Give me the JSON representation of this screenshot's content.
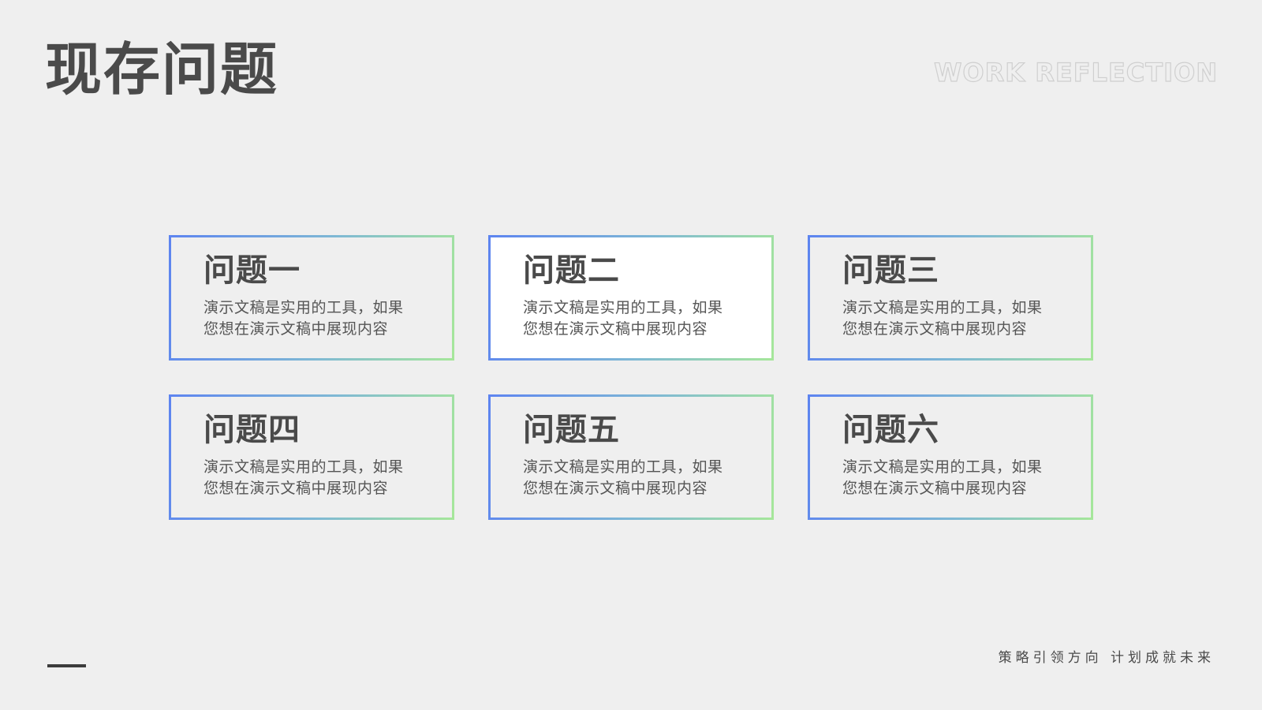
{
  "header": {
    "title": "现存问题",
    "subtitle_en": "WORK REFLECTION"
  },
  "cards": [
    {
      "title": "问题一",
      "line1": "演示文稿是实用的工具，如果",
      "line2": "您想在演示文稿中展现内容"
    },
    {
      "title": "问题二",
      "line1": "演示文稿是实用的工具，如果",
      "line2": "您想在演示文稿中展现内容"
    },
    {
      "title": "问题三",
      "line1": "演示文稿是实用的工具，如果",
      "line2": "您想在演示文稿中展现内容"
    },
    {
      "title": "问题四",
      "line1": "演示文稿是实用的工具，如果",
      "line2": "您想在演示文稿中展现内容"
    },
    {
      "title": "问题五",
      "line1": "演示文稿是实用的工具，如果",
      "line2": "您想在演示文稿中展现内容"
    },
    {
      "title": "问题六",
      "line1": "演示文稿是实用的工具，如果",
      "line2": "您想在演示文稿中展现内容"
    }
  ],
  "footer": {
    "slogan": "策略引领方向 计划成就未来"
  },
  "colors": {
    "background": "#efefef",
    "text": "#4a4a4a",
    "gradient_start": "#5d84f0",
    "gradient_end": "#a6e79a",
    "highlight_card_fill": "#ffffff"
  }
}
